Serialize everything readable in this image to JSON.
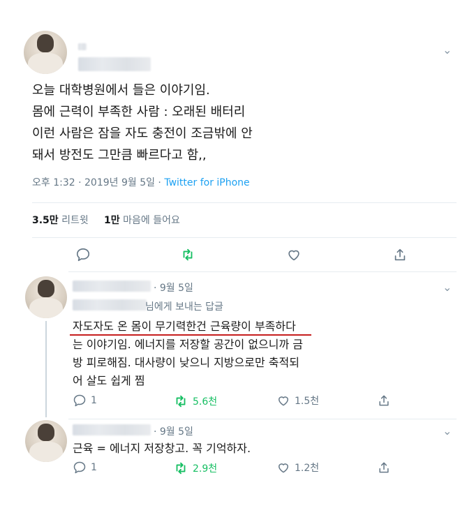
{
  "main_tweet": {
    "text_lines": [
      "오늘 대학병원에서 들은 이야기임.",
      "몸에 근력이 부족한 사람 : 오래된 배터리",
      "이런 사람은 잠을 자도 충전이 조금밖에 안",
      "돼서 방전도 그만큼 빠르다고 함,,"
    ],
    "timestamp": "오후 1:32 · 2019년 9월 5일 · ",
    "source": "Twitter for iPhone",
    "retweet_count": "3.5만",
    "retweet_label": "리트윗",
    "like_count": "1만",
    "like_label": "마음에 들어요"
  },
  "reply1": {
    "date": "· 9월 5일",
    "replying_to": "님에게 보내는 답글",
    "text_lines": [
      "자도자도 온 몸이 무기력한건 근육량이 부족하다",
      "는 이야기임. 에너지를 저장할 공간이 없으니까 금",
      "방 피로해짐. 대사량이 낮으니 지방으로만 축적되",
      "어 살도 쉽게 찜"
    ],
    "reply_count": "1",
    "retweet_count": "5.6천",
    "like_count": "1.5천"
  },
  "reply2": {
    "date": "· 9월 5일",
    "text": "근육 = 에너지 저장창고. 꼭 기억하자.",
    "reply_count": "1",
    "retweet_count": "2.9천",
    "like_count": "1.2천"
  },
  "colors": {
    "retweet_green": "#17bf63",
    "link_blue": "#1da1f2",
    "underline_red": "#c61e1e"
  }
}
